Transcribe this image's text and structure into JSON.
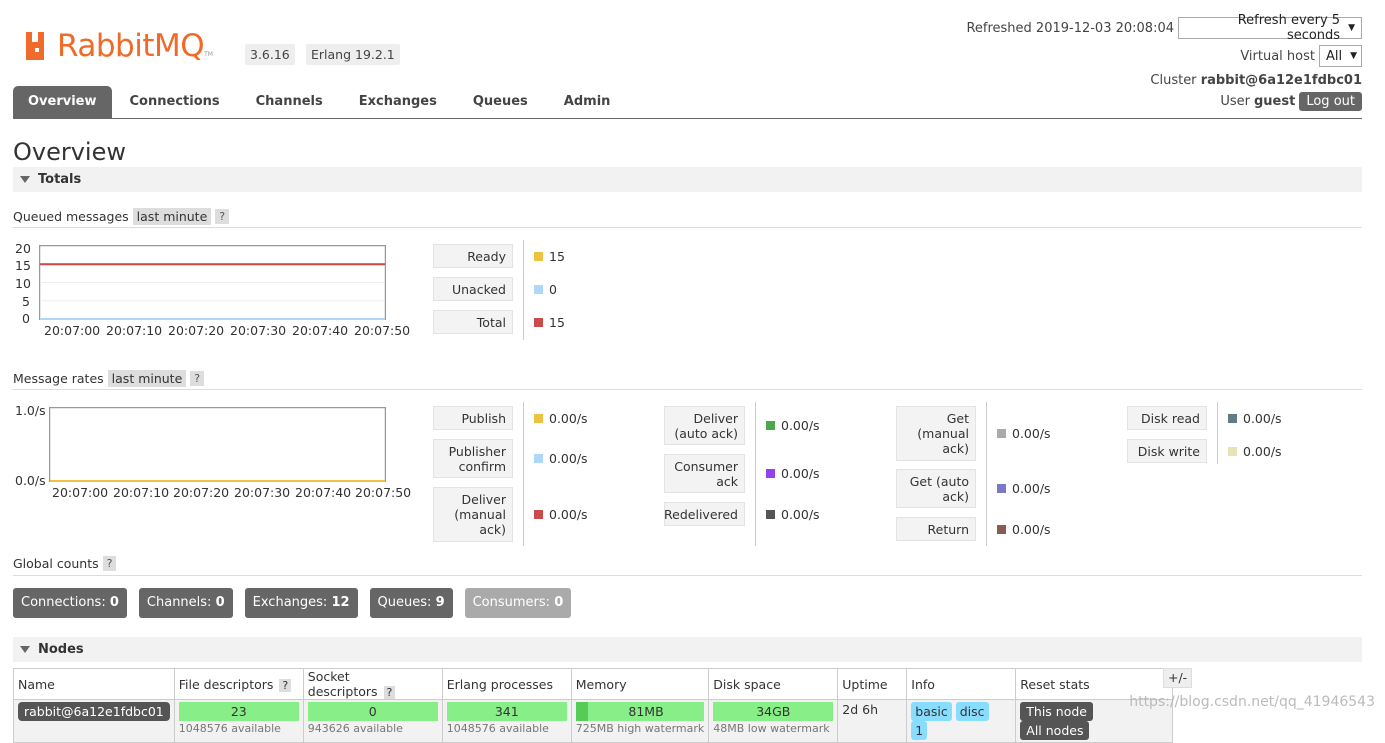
{
  "header": {
    "logo_text": "RabbitMQ",
    "version": "3.6.16",
    "erlang": "Erlang 19.2.1",
    "refreshed_label": "Refreshed 2019-12-03 20:08:04",
    "refresh_select": "Refresh every 5 seconds",
    "vhost_label": "Virtual host",
    "vhost_select": "All",
    "cluster_label": "Cluster",
    "cluster_name": "rabbit@6a12e1fdbc01",
    "user_label": "User",
    "user_name": "guest",
    "logout": "Log out"
  },
  "tabs": [
    "Overview",
    "Connections",
    "Channels",
    "Exchanges",
    "Queues",
    "Admin"
  ],
  "page_title": "Overview",
  "totals": {
    "section": "Totals",
    "queued": {
      "title": "Queued messages",
      "range": "last minute",
      "help": "?",
      "yticks": [
        "20",
        "15",
        "10",
        "5",
        "0"
      ],
      "xticks": [
        "20:07:00",
        "20:07:10",
        "20:07:20",
        "20:07:30",
        "20:07:40",
        "20:07:50"
      ],
      "legend": [
        {
          "label": "Ready",
          "value": "15",
          "color": "#edc240"
        },
        {
          "label": "Unacked",
          "value": "0",
          "color": "#afd8f8"
        },
        {
          "label": "Total",
          "value": "15",
          "color": "#cb4b4b"
        }
      ]
    },
    "rates": {
      "title": "Message rates",
      "range": "last minute",
      "help": "?",
      "yticks": [
        "1.0/s",
        "0.0/s"
      ],
      "xticks": [
        "20:07:00",
        "20:07:10",
        "20:07:20",
        "20:07:30",
        "20:07:40",
        "20:07:50"
      ],
      "col1": [
        {
          "label": "Publish",
          "value": "0.00/s",
          "color": "#edc240"
        },
        {
          "label": "Publisher confirm",
          "value": "0.00/s",
          "color": "#afd8f8"
        },
        {
          "label": "Deliver (manual ack)",
          "value": "0.00/s",
          "color": "#cb4b4b"
        }
      ],
      "col2": [
        {
          "label": "Deliver (auto ack)",
          "value": "0.00/s",
          "color": "#4da74d"
        },
        {
          "label": "Consumer ack",
          "value": "0.00/s",
          "color": "#9440ed"
        },
        {
          "label": "Redelivered",
          "value": "0.00/s",
          "color": "#555555"
        }
      ],
      "col3": [
        {
          "label": "Get (manual ack)",
          "value": "0.00/s",
          "color": "#aaaaaa"
        },
        {
          "label": "Get (auto ack)",
          "value": "0.00/s",
          "color": "#7c79c3"
        },
        {
          "label": "Return",
          "value": "0.00/s",
          "color": "#8c5b50"
        }
      ],
      "col4": [
        {
          "label": "Disk read",
          "value": "0.00/s",
          "color": "#637b85"
        },
        {
          "label": "Disk write",
          "value": "0.00/s",
          "color": "#e5e5b4"
        }
      ]
    },
    "global": {
      "title": "Global counts",
      "help": "?",
      "items": [
        {
          "label": "Connections:",
          "value": "0"
        },
        {
          "label": "Channels:",
          "value": "0"
        },
        {
          "label": "Exchanges:",
          "value": "12"
        },
        {
          "label": "Queues:",
          "value": "9"
        },
        {
          "label": "Consumers:",
          "value": "0"
        }
      ]
    }
  },
  "nodes": {
    "section": "Nodes",
    "plusminus": "+/-",
    "columns": [
      "Name",
      "File descriptors",
      "Socket descriptors",
      "Erlang processes",
      "Memory",
      "Disk space",
      "Uptime",
      "Info",
      "Reset stats"
    ],
    "help": "?",
    "row": {
      "name": "rabbit@6a12e1fdbc01",
      "fd": "23",
      "fd_sub": "1048576 available",
      "sd": "0",
      "sd_sub": "943626 available",
      "ep": "341",
      "ep_sub": "1048576 available",
      "mem": "81MB",
      "mem_sub": "725MB high watermark",
      "disk": "34GB",
      "disk_sub": "48MB low watermark",
      "uptime": "2d 6h",
      "info": [
        "basic",
        "disc",
        "1"
      ],
      "reset": [
        "This node",
        "All nodes"
      ]
    }
  },
  "watermark": "https://blog.csdn.net/qq_41946543",
  "chart_data": [
    {
      "type": "line",
      "title": "Queued messages",
      "x": [
        "20:07:00",
        "20:07:10",
        "20:07:20",
        "20:07:30",
        "20:07:40",
        "20:07:50"
      ],
      "ylim": [
        0,
        20
      ],
      "series": [
        {
          "name": "Ready",
          "values": [
            15,
            15,
            15,
            15,
            15,
            15
          ]
        },
        {
          "name": "Unacked",
          "values": [
            0,
            0,
            0,
            0,
            0,
            0
          ]
        },
        {
          "name": "Total",
          "values": [
            15,
            15,
            15,
            15,
            15,
            15
          ]
        }
      ]
    },
    {
      "type": "line",
      "title": "Message rates",
      "x": [
        "20:07:00",
        "20:07:10",
        "20:07:20",
        "20:07:30",
        "20:07:40",
        "20:07:50"
      ],
      "ylim": [
        0,
        1
      ],
      "series": [
        {
          "name": "Publish",
          "values": [
            0,
            0,
            0,
            0,
            0,
            0
          ]
        }
      ]
    }
  ]
}
